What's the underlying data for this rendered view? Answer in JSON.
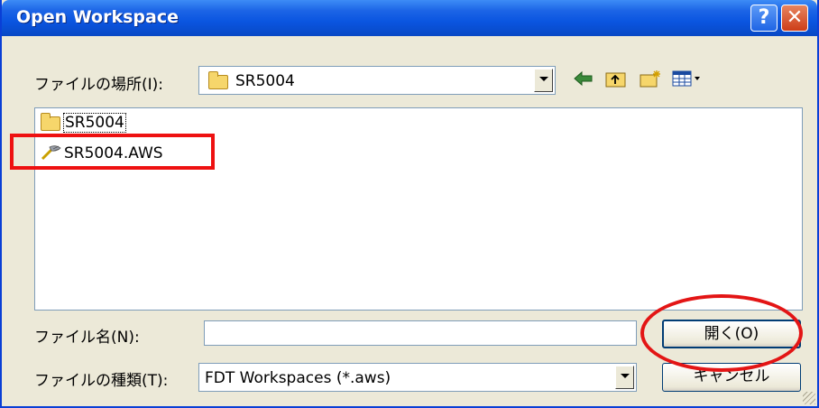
{
  "window": {
    "title": "Open Workspace",
    "help_label": "?",
    "close_label": "✕"
  },
  "location": {
    "label": "ファイルの場所(I):",
    "value": "SR5004"
  },
  "files": [
    {
      "name": "SR5004",
      "icon": "folder-icon"
    },
    {
      "name": "SR5004.AWS",
      "icon": "aws-workspace-icon"
    }
  ],
  "filename": {
    "label": "ファイル名(N):",
    "value": ""
  },
  "filetype": {
    "label": "ファイルの種類(T):",
    "value": "FDT Workspaces (*.aws)"
  },
  "buttons": {
    "open": "開く(O)",
    "cancel": "キャンセル"
  },
  "colors": {
    "annotation": "#e31515",
    "titlebar": "#0a55e0"
  }
}
